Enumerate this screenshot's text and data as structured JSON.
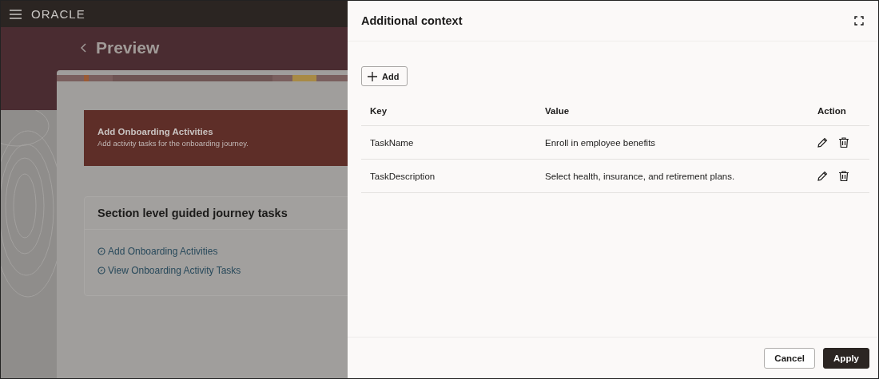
{
  "header": {
    "logo": "ORACLE"
  },
  "page": {
    "title": "Preview",
    "banner": {
      "title": "Add Onboarding Activities",
      "subtitle": "Add activity tasks for the onboarding journey."
    },
    "section": {
      "title": "Section level guided journey tasks",
      "links": [
        "Add Onboarding Activities",
        "View Onboarding Activity Tasks"
      ]
    }
  },
  "drawer": {
    "title": "Additional context",
    "add_button": "Add",
    "table": {
      "columns": [
        "Key",
        "Value",
        "Action"
      ],
      "rows": [
        {
          "key": "TaskName",
          "value": "Enroll in employee benefits"
        },
        {
          "key": "TaskDescription",
          "value": "Select health, insurance, and retirement plans."
        }
      ]
    },
    "buttons": [
      {
        "label": "Cancel",
        "kind": "secondary"
      },
      {
        "label": "Apply",
        "kind": "primary"
      }
    ]
  }
}
